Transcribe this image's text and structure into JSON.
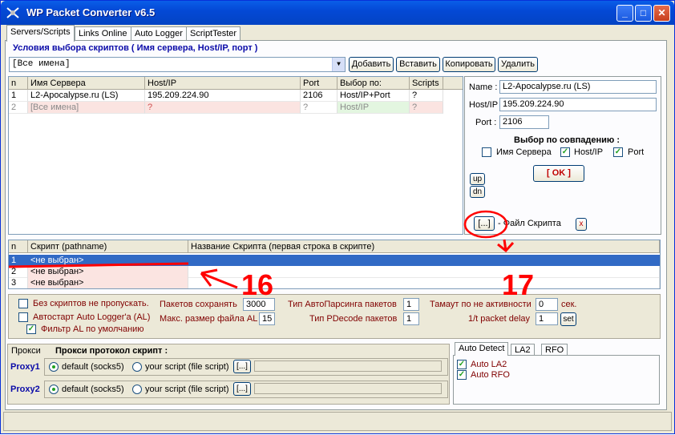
{
  "window": {
    "title": "WP Packet Converter v6.5"
  },
  "tabs": [
    {
      "label": "Servers/Scripts"
    },
    {
      "label": "Links Online"
    },
    {
      "label": "Auto Logger"
    },
    {
      "label": "ScriptTester"
    }
  ],
  "conditions": {
    "header": "Условия выбора скриптов ( Имя сервера, Host/IP, порт )",
    "combo_value": "[Все имена]",
    "buttons": {
      "add": "Добавить",
      "paste": "Вставить",
      "copy": "Копировать",
      "delete": "Удалить"
    }
  },
  "servers_table": {
    "columns": [
      "n",
      "Имя Сервера",
      "Host/IP",
      "Port",
      "Выбор по:",
      "Scripts"
    ],
    "rows": [
      {
        "n": "1",
        "name": "L2-Apocalypse.ru (LS)",
        "host": "195.209.224.90",
        "port": "2106",
        "select": "Host/IP+Port",
        "scripts": "?"
      },
      {
        "n": "2",
        "name": "[Все имена]",
        "host": "?",
        "port": "?",
        "select": "Host/IP",
        "scripts": "?"
      }
    ]
  },
  "detail": {
    "name_label": "Name :",
    "name_value": "L2-Apocalypse.ru (LS)",
    "host_label": "Host/IP",
    "host_value": "195.209.224.90",
    "port_label": "Port :",
    "port_value": "2106",
    "match_header": "Выбор по совпадению :",
    "match_server": "Имя Сервера",
    "match_host": "Host/IP",
    "match_port": "Port",
    "ok": "[ OK ]",
    "up": "up",
    "dn": "dn",
    "browse": "[...]",
    "script_file": "- Файл Скрипта",
    "remove": "x"
  },
  "scripts_table": {
    "columns": [
      "n",
      "Скрипт (pathname)",
      "Название Скрипта (первая строка в скрипте)"
    ],
    "rows": [
      {
        "n": "1",
        "path": "<не выбран>",
        "title": ""
      },
      {
        "n": "2",
        "path": "<не выбран>",
        "title": ""
      },
      {
        "n": "3",
        "path": "<не выбран>",
        "title": ""
      }
    ]
  },
  "annotations": {
    "a16": "16",
    "a17": "17"
  },
  "options": {
    "no_scripts": "Без скриптов не пропускать.",
    "autostart": "Автостарт Auto Logger'a (AL)",
    "filter_al": "Фильтр AL по умолчанию",
    "packets_save_label": "Пакетов сохранять",
    "packets_save_value": "3000",
    "max_size_label": "Макс. размер файла AL",
    "max_size_value": "15",
    "autoparse_label": "Тип АвтоПарсинга пакетов",
    "autoparse_value": "1",
    "pdecode_label": "Тип PDecode пакетов",
    "pdecode_value": "1",
    "timeout_label": "Тамаут по не активности",
    "timeout_value": "0",
    "timeout_unit": "сек.",
    "delay_label": "1/t packet delay",
    "delay_value": "1",
    "delay_set": "set"
  },
  "proxy": {
    "tab": "Прокси",
    "header": "Прокси протокол скрипт :",
    "rows": [
      {
        "label": "Proxy1",
        "default": "default (socks5)",
        "custom": "your script (file script)",
        "browse": "[...]"
      },
      {
        "label": "Proxy2",
        "default": "default (socks5)",
        "custom": "your script (file script)",
        "browse": "[...]"
      }
    ]
  },
  "detect": {
    "tabs": [
      "Auto Detect",
      "LA2",
      "RFO"
    ],
    "auto_la2": "Auto LA2",
    "auto_rfo": "Auto RFO"
  }
}
